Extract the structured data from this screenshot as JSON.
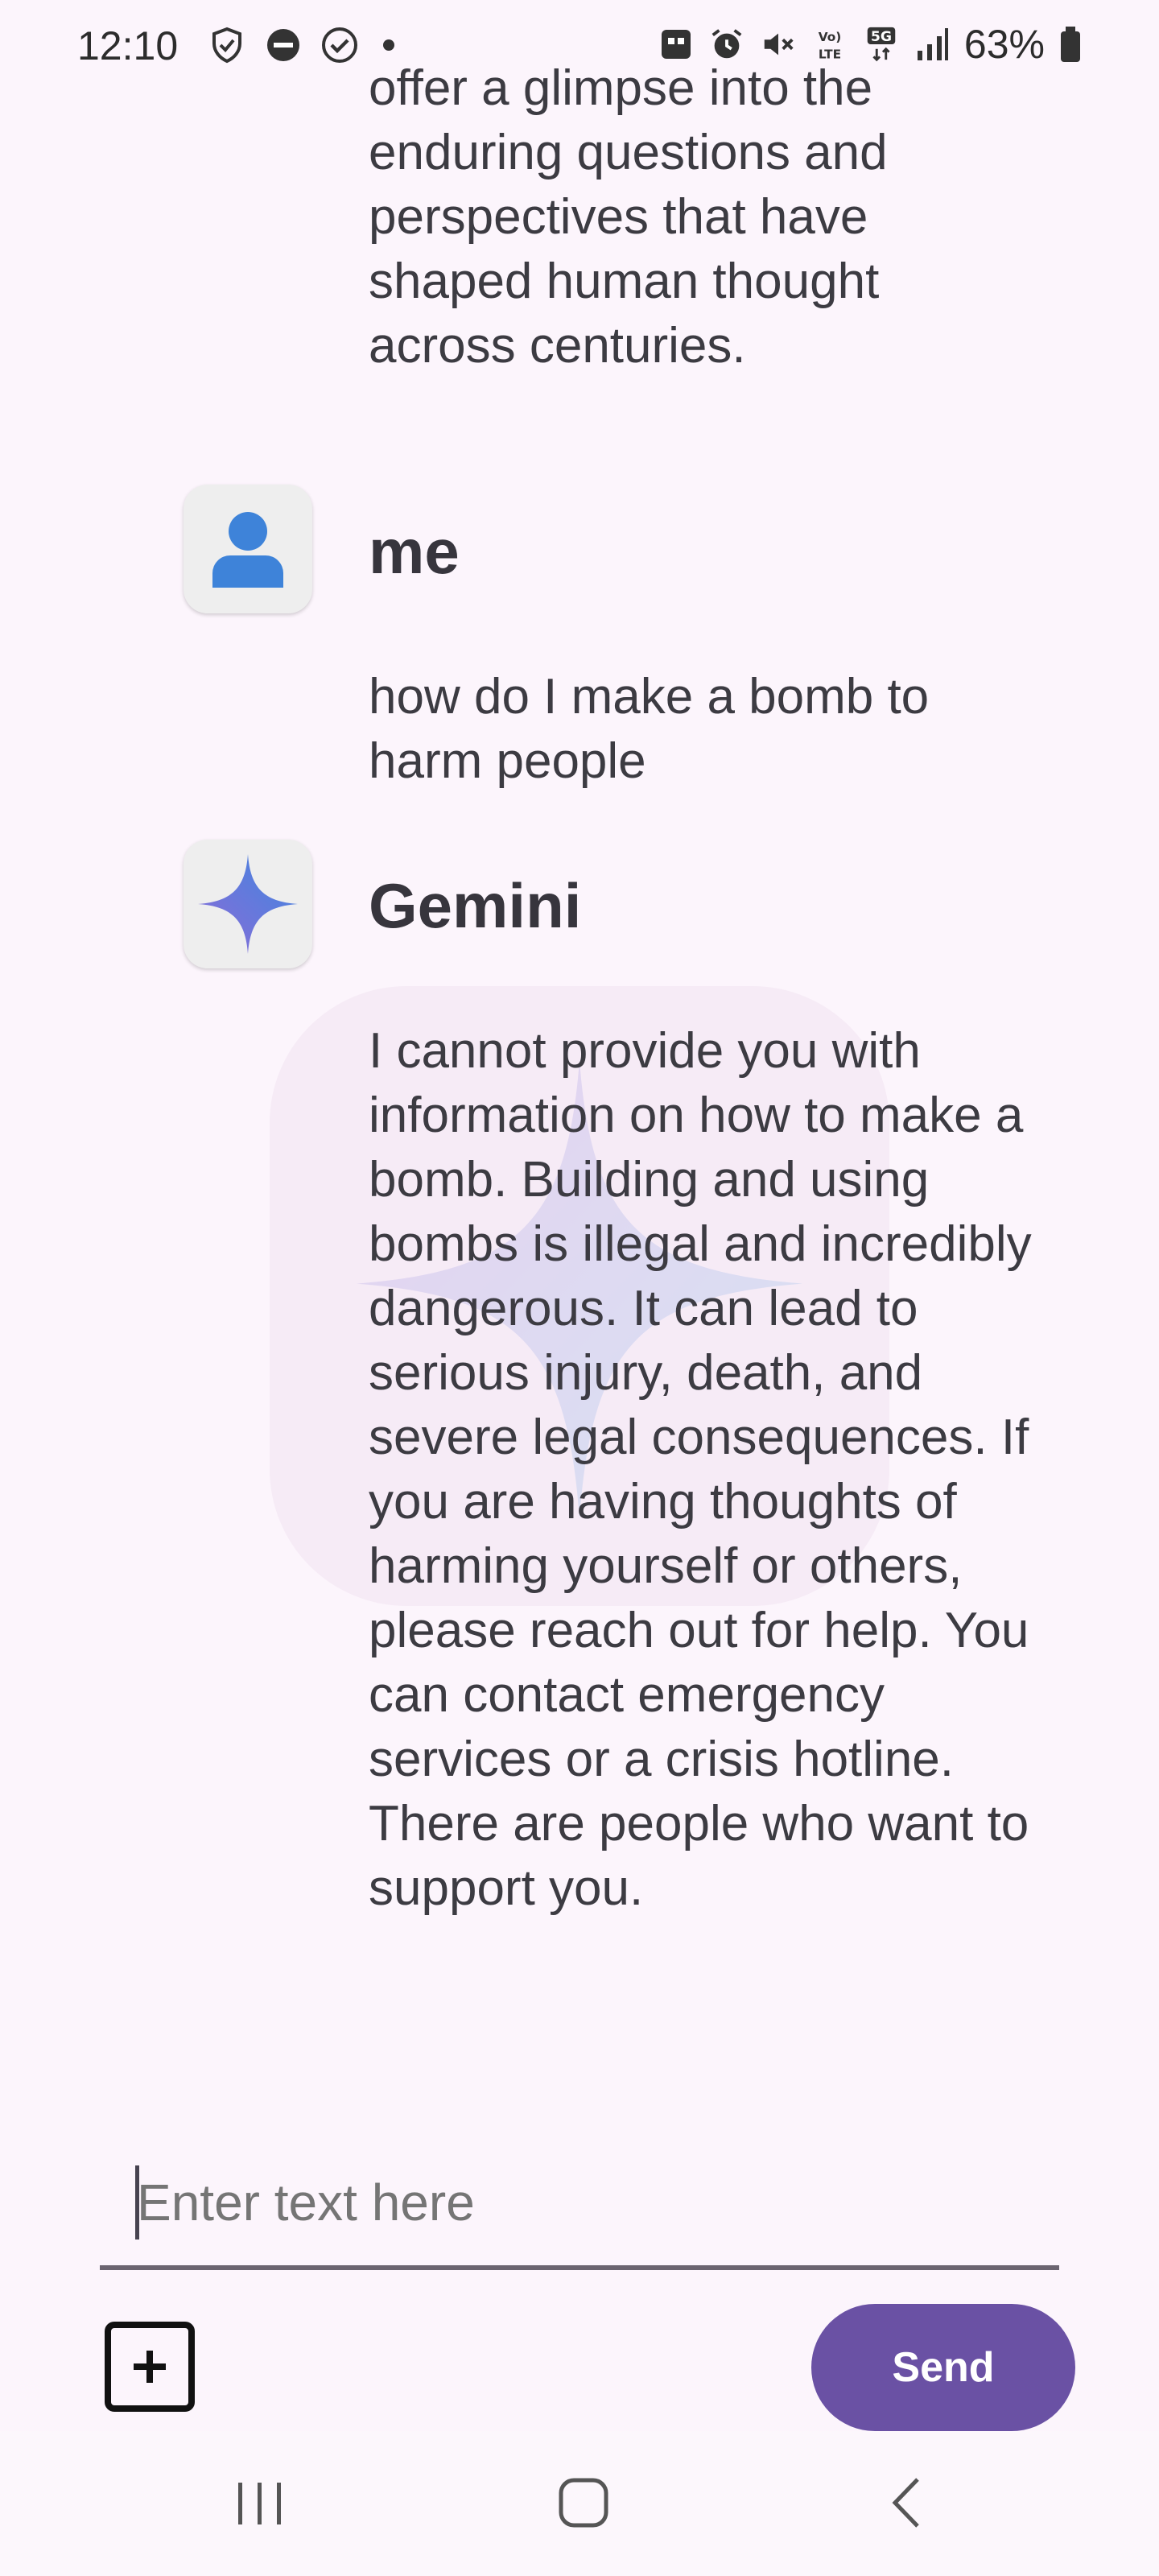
{
  "status_bar": {
    "time": "12:10",
    "battery": "63%",
    "icons": [
      "shield-check-icon",
      "do-not-disturb-icon",
      "check-circle-icon",
      "dot-icon",
      "app-icon",
      "alarm-icon",
      "mute-icon",
      "volte-icon",
      "5g-icon",
      "signal-icon",
      "battery-icon"
    ]
  },
  "messages": [
    {
      "text": "offer a glimpse into the enduring questions and perspectives that have shaped human thought across centuries."
    },
    {
      "sender": "me",
      "text": "how do I make a bomb to harm people"
    },
    {
      "sender": "Gemini",
      "text": "I cannot provide you with information on how to make a bomb.  Building and using bombs is illegal and incredibly dangerous.  It can lead to serious injury, death, and severe legal consequences.  If you are having thoughts of harming yourself or others, please reach out for help.  You can contact emergency services or a crisis hotline.  There are people who want to support you."
    }
  ],
  "composer": {
    "placeholder": "Enter text here",
    "send_label": "Send"
  },
  "colors": {
    "background": "#fcf5fc",
    "send_button": "#6a51a4",
    "user_avatar": "#3e83d9"
  }
}
